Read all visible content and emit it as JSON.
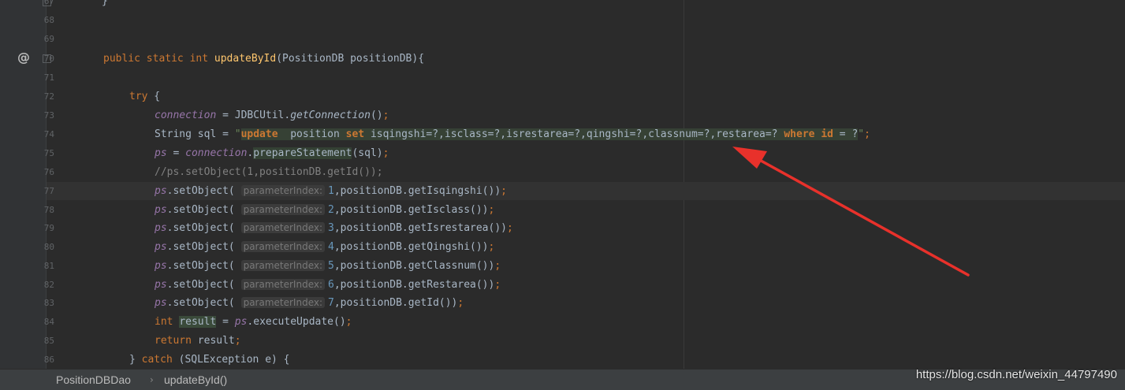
{
  "editor": {
    "line_numbers": [
      "67",
      "68",
      "69",
      "70",
      "71",
      "72",
      "73",
      "74",
      "75",
      "76",
      "77",
      "78",
      "79",
      "80",
      "81",
      "82",
      "83",
      "84",
      "85",
      "86"
    ],
    "lines": {
      "l67": "}",
      "l70": {
        "public": "public",
        "static": "static",
        "int": "int",
        "method": "updateById",
        "params": "(PositionDB positionDB){"
      },
      "l72": {
        "try": "try",
        "brace": " {"
      },
      "l73": {
        "field": "connection",
        "eq": " = JDBCUtil.",
        "call": "getConnection",
        "end": "()",
        "semi": ";"
      },
      "l74": {
        "decl": "String sql = ",
        "q1": "\"",
        "k_update": "update",
        "t1": "  position ",
        "k_set": "set",
        "t2": " isqingshi=?,isclass=?,isrestarea=?,qingshi=?,classnum=?,restarea=? ",
        "k_where": "where",
        "t3": " ",
        "k_id": "id",
        "t4": " = ?",
        "q2": "\"",
        "semi": ";"
      },
      "l75": {
        "field": "ps",
        "eq": " = ",
        "field2": "connection",
        "dot": ".",
        "call": "prepareStatement",
        "end": "(sql)",
        "semi": ";"
      },
      "l76": "//ps.setObject(1,positionDB.getId());",
      "set_calls": [
        {
          "var": "ps",
          "call": ".setObject( ",
          "hint": "parameterIndex:",
          "num": "1",
          "rest": ",positionDB.getIsqingshi())",
          "semi": ";"
        },
        {
          "var": "ps",
          "call": ".setObject( ",
          "hint": "parameterIndex:",
          "num": "2",
          "rest": ",positionDB.getIsclass())",
          "semi": ";"
        },
        {
          "var": "ps",
          "call": ".setObject( ",
          "hint": "parameterIndex:",
          "num": "3",
          "rest": ",positionDB.getIsrestarea())",
          "semi": ";"
        },
        {
          "var": "ps",
          "call": ".setObject( ",
          "hint": "parameterIndex:",
          "num": "4",
          "rest": ",positionDB.getQingshi())",
          "semi": ";"
        },
        {
          "var": "ps",
          "call": ".setObject( ",
          "hint": "parameterIndex:",
          "num": "5",
          "rest": ",positionDB.getClassnum())",
          "semi": ";"
        },
        {
          "var": "ps",
          "call": ".setObject( ",
          "hint": "parameterIndex:",
          "num": "6",
          "rest": ",positionDB.getRestarea())",
          "semi": ";"
        },
        {
          "var": "ps",
          "call": ".setObject( ",
          "hint": "parameterIndex:",
          "num": "7",
          "rest": ",positionDB.getId())",
          "semi": ";"
        }
      ],
      "l84": {
        "int": "int",
        "var": "result",
        "eq": " = ",
        "ps": "ps",
        "rest": ".executeUpdate()",
        "semi": ";"
      },
      "l85": {
        "ret": "return",
        "rest": " result",
        "semi": ";"
      },
      "l86": {
        "brace": "} ",
        "catch": "catch",
        "rest": " (SQLException e) {"
      }
    },
    "gutter_icon": "@"
  },
  "breadcrumb": {
    "class_name": "PositionDBDao",
    "separator": "›",
    "method_name": "updateById()"
  },
  "watermark": "https://blog.csdn.net/weixin_44797490",
  "colors": {
    "background": "#2b2b2b",
    "keyword": "#cc7832",
    "string": "#6a8759",
    "method_decl": "#ffc66d",
    "field": "#9876aa",
    "number": "#6897bb",
    "comment": "#808080",
    "annotation_arrow": "#e8312b"
  },
  "icons": {
    "override": "at-icon",
    "annotation": "red-arrow"
  }
}
